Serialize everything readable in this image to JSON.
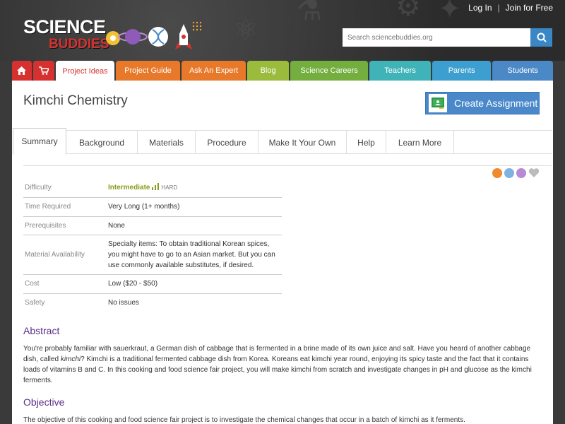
{
  "header": {
    "logo_line1": "SCIENCE",
    "logo_line2": "BUDDIES",
    "login": "Log In",
    "separator": "|",
    "join": "Join for Free",
    "search_placeholder": "Search sciencebuddies.org",
    "icons": [
      "home-icon",
      "cart-icon",
      "search-icon"
    ]
  },
  "nav": {
    "items": [
      {
        "label": "Project Ideas",
        "color": "#ffffff"
      },
      {
        "label": "Project Guide",
        "color": "#e8792b"
      },
      {
        "label": "Ask An Expert",
        "color": "#e8792b"
      },
      {
        "label": "Blog",
        "color": "#9bbb3c"
      },
      {
        "label": "Science Careers",
        "color": "#73ae3f"
      },
      {
        "label": "Teachers",
        "color": "#3fb3b8"
      },
      {
        "label": "Parents",
        "color": "#3c9fd0"
      },
      {
        "label": "Students",
        "color": "#4a88c6"
      }
    ],
    "home_color": "#d7312f",
    "cart_color": "#d7312f"
  },
  "page": {
    "title": "Kimchi Chemistry",
    "create_assignment": "Create Assignment"
  },
  "tabs": [
    "Summary",
    "Background",
    "Materials",
    "Procedure",
    "Make It Your Own",
    "Help",
    "Learn More"
  ],
  "details": {
    "difficulty_label": "Difficulty",
    "difficulty_value": "Intermediate",
    "difficulty_level": "HARD",
    "time_label": "Time Required",
    "time_value": "Very Long (1+ months)",
    "prereq_label": "Prerequisites",
    "prereq_value": "None",
    "material_label": "Material Availability",
    "material_value": "Specialty items: To obtain traditional Korean spices, you might have to go to an Asian market. But you can use commonly available substitutes, if desired.",
    "cost_label": "Cost",
    "cost_value": "Low ($20 - $50)",
    "safety_label": "Safety",
    "safety_value": "No issues"
  },
  "abstract": {
    "title": "Abstract",
    "text_before": "You're probably familiar with sauerkraut, a German dish of cabbage that is fermented in a brine made of its own juice and salt. Have you heard of another cabbage dish, called ",
    "text_italic": "kimchi",
    "text_after": "? Kimchi is a traditional fermented cabbage dish from Korea. Koreans eat kimchi year round, enjoying its spicy taste and the fact that it contains loads of vitamins B and C. In this cooking and food science fair project, you will make kimchi from scratch and investigate changes in pH and glucose as the kimchi ferments."
  },
  "objective": {
    "title": "Objective",
    "text": "The objective of this cooking and food science fair project is to investigate the chemical changes that occur in a batch of kimchi as it ferments."
  }
}
